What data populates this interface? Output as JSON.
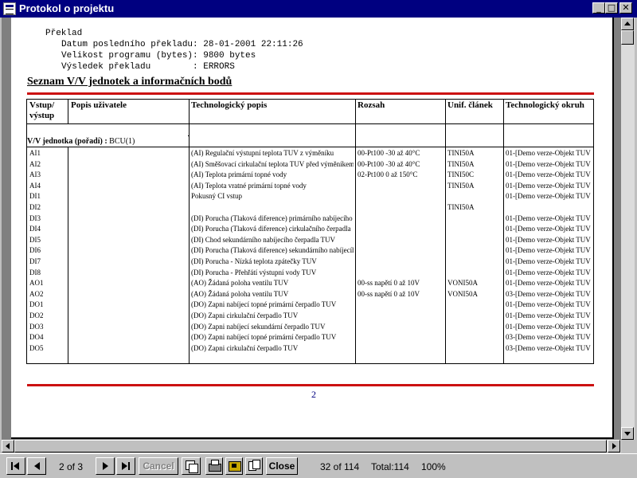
{
  "window": {
    "title": "Protokol o projektu",
    "buttons": {
      "minimize": "_",
      "maximize": "□",
      "close": "✕"
    }
  },
  "report": {
    "compile_section": {
      "heading": "Překlad",
      "lines": [
        "Datum posledního překladu: 28-01-2001 22:11:26",
        "Velikost programu (bytes): 9800 bytes",
        "Výsledek překladu        : ERRORS"
      ]
    },
    "io_section_title": "Seznam V/V jednotek a informačních bodů",
    "table": {
      "headers": [
        "Vstup/ výstup",
        "Popis uživatele",
        "Technologický popis",
        "Rozsah",
        "Unif. článek",
        "Technologický okruh"
      ],
      "group_label": "V/V jednotka (pořadí) :",
      "group_value": "BCU(1)",
      "rows": [
        {
          "io": "AI1",
          "user": "",
          "tech": "(AI) Regulační výstupní teplota TUV z výměníku",
          "range": "00-Pt100   -30 až  40°C",
          "unif": "TINI50A",
          "circuit": "01-[Demo verze-Objekt TUV"
        },
        {
          "io": "AI2",
          "user": "",
          "tech": "(AI) Směšovací cirkulační teplota TUV před výměníkem",
          "range": "00-Pt100   -30 až  40°C",
          "unif": "TINI50A",
          "circuit": "01-[Demo verze-Objekt TUV"
        },
        {
          "io": "AI3",
          "user": "",
          "tech": "(AI) Teplota primární topné vody",
          "range": "02-Pt100    0 až 150°C",
          "unif": "TINI50C",
          "circuit": "01-[Demo verze-Objekt TUV"
        },
        {
          "io": "AI4",
          "user": "",
          "tech": "(AI) Teplota vratné primární topné vody",
          "range": "",
          "unif": "TINI50A",
          "circuit": "01-[Demo verze-Objekt TUV"
        },
        {
          "io": "DI1",
          "user": "",
          "tech": "Pokusný CI vstup",
          "range": "",
          "unif": "",
          "circuit": "01-[Demo verze-Objekt TUV"
        },
        {
          "io": "DI2",
          "user": "",
          "tech": "",
          "range": "",
          "unif": "TINI50A",
          "circuit": ""
        },
        {
          "io": "DI3",
          "user": "",
          "tech": "(DI) Porucha (Tlaková diference) primárního nabíjecího čerpadla",
          "range": "",
          "unif": "",
          "circuit": "01-[Demo verze-Objekt TUV"
        },
        {
          "io": "DI4",
          "user": "",
          "tech": "(DI) Porucha (Tlaková diference) cirkulačního čerpadla",
          "range": "",
          "unif": "",
          "circuit": "01-[Demo verze-Objekt TUV"
        },
        {
          "io": "DI5",
          "user": "",
          "tech": "(DI) Chod sekundárního nabíjecího čerpadla TUV",
          "range": "",
          "unif": "",
          "circuit": "01-[Demo verze-Objekt TUV"
        },
        {
          "io": "DI6",
          "user": "",
          "tech": "(DI) Porucha (Tlaková diference) sekundárního nabíjecího čerpadla",
          "range": "",
          "unif": "",
          "circuit": "01-[Demo verze-Objekt TUV"
        },
        {
          "io": "DI7",
          "user": "",
          "tech": "(DI) Porucha - Nízká teplota zpátečky TUV",
          "range": "",
          "unif": "",
          "circuit": "01-[Demo verze-Objekt TUV"
        },
        {
          "io": "DI8",
          "user": "",
          "tech": "(DI) Porucha - Přehřátí výstupní vody TUV",
          "range": "",
          "unif": "",
          "circuit": "01-[Demo verze-Objekt TUV"
        },
        {
          "io": "AO1",
          "user": "",
          "tech": "(AO) Žádaná poloha ventilu TUV",
          "range": "00-ss napětí 0 až 10V",
          "unif": "VONI50A",
          "circuit": "01-[Demo verze-Objekt TUV"
        },
        {
          "io": "AO2",
          "user": "",
          "tech": "(AO) Žádaná poloha ventilu TUV",
          "range": "00-ss napětí 0 až 10V",
          "unif": "VONI50A",
          "circuit": "03-[Demo verze-Objekt TUV"
        },
        {
          "io": "DO1",
          "user": "",
          "tech": "(DO) Zapni nabíjecí topné primární čerpadlo TUV",
          "range": "",
          "unif": "",
          "circuit": "01-[Demo verze-Objekt TUV"
        },
        {
          "io": "DO2",
          "user": "",
          "tech": "(DO) Zapni cirkulační čerpadlo TUV",
          "range": "",
          "unif": "",
          "circuit": "01-[Demo verze-Objekt TUV"
        },
        {
          "io": "DO3",
          "user": "",
          "tech": "(DO) Zapni nabíjecí sekundární čerpadlo TUV",
          "range": "",
          "unif": "",
          "circuit": "01-[Demo verze-Objekt TUV"
        },
        {
          "io": "DO4",
          "user": "",
          "tech": "(DO) Zapni nabíjecí topné primární čerpadlo TUV",
          "range": "",
          "unif": "",
          "circuit": "03-[Demo verze-Objekt TUV"
        },
        {
          "io": "DO5",
          "user": "",
          "tech": "(DO) Zapni cirkulační čerpadlo TUV",
          "range": "",
          "unif": "",
          "circuit": "03-[Demo verze-Objekt TUV"
        }
      ]
    },
    "page_number": "2"
  },
  "toolbar": {
    "page_indicator": "2 of 3",
    "cancel_label": "Cancel",
    "close_label": "Close",
    "record_position": "32 of 114",
    "total": "Total:114",
    "zoom": "100%"
  },
  "colors": {
    "titlebar": "#000080",
    "rule": "#cc1111",
    "page_number": "#000080"
  }
}
